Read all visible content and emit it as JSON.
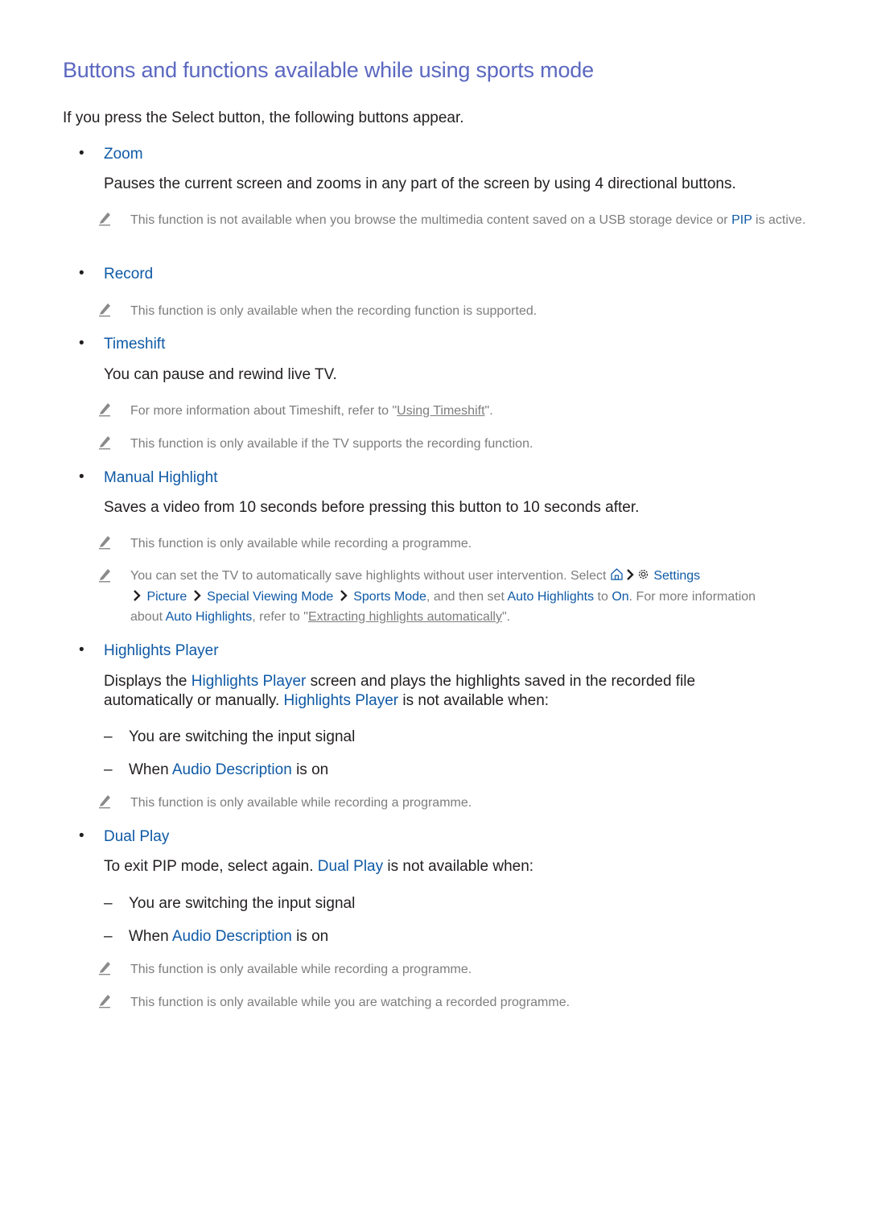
{
  "heading": "Buttons and functions available while using sports mode",
  "intro": "If you press the Select button, the following buttons appear.",
  "colors": {
    "heading": "#5b68c0",
    "link": "#0f5aa6",
    "body": "#231f20",
    "note": "#7d7d7d"
  },
  "icons": {
    "bullet": "bullet-dot",
    "note": "pencil-icon",
    "home": "home-icon",
    "settings": "gear-icon",
    "chevron": "chevron-right-icon"
  },
  "items": [
    {
      "title": "Zoom",
      "description": "Pauses the current screen and zooms in any part of the screen by using 4 directional buttons.",
      "notes": [
        {
          "prefix": "This function is not available when you browse the multimedia content saved on a USB storage device or ",
          "link": "PIP",
          "suffix": " is active."
        }
      ]
    },
    {
      "title": "Record",
      "notes": [
        {
          "text": "This function is only available when the recording function is supported."
        }
      ]
    },
    {
      "title": "Timeshift",
      "description": "You can pause and rewind live TV.",
      "notes": [
        {
          "prefix": "For more information about Timeshift, refer to \"",
          "ref": "Using Timeshift",
          "suffix": "\"."
        },
        {
          "text": "This function is only available if the TV supports the recording function."
        }
      ]
    },
    {
      "title": "Manual Highlight",
      "description": "Saves a video from 10 seconds before pressing this button to 10 seconds after.",
      "notes": [
        {
          "text": "This function is only available while recording a programme."
        },
        {
          "part1": "You can set the TV to automatically save highlights without user intervention. Select ",
          "path": [
            "Settings",
            "Picture",
            "Special Viewing Mode",
            "Sports Mode"
          ],
          "part2": ", and then set ",
          "setting": "Auto Highlights",
          "part3": " to ",
          "value": "On",
          "part4": ". For more information about ",
          "setting2": "Auto Highlights",
          "part5": ", refer to \"",
          "ref": "Extracting highlights automatically",
          "part6": "\"."
        }
      ]
    },
    {
      "title": "Highlights Player",
      "desc_part1": "Displays the ",
      "desc_link1": "Highlights Player",
      "desc_part2": " screen and plays the highlights saved in the recorded file automatically or manually. ",
      "desc_link2": "Highlights Player",
      "desc_part3": " is not available when:",
      "conditions": [
        {
          "text": "You are switching the input signal"
        },
        {
          "prefix": "When ",
          "link": "Audio Description",
          "suffix": " is on"
        }
      ],
      "notes": [
        {
          "text": "This function is only available while recording a programme."
        }
      ]
    },
    {
      "title": "Dual Play",
      "desc_part1": "To exit PIP mode, select again. ",
      "desc_link1": "Dual Play",
      "desc_part2": " is not available when:",
      "conditions": [
        {
          "text": "You are switching the input signal"
        },
        {
          "prefix": "When ",
          "link": "Audio Description",
          "suffix": " is on"
        }
      ],
      "notes": [
        {
          "text": "This function is only available while recording a programme."
        },
        {
          "text": "This function is only available while you are watching a recorded programme."
        }
      ]
    }
  ]
}
